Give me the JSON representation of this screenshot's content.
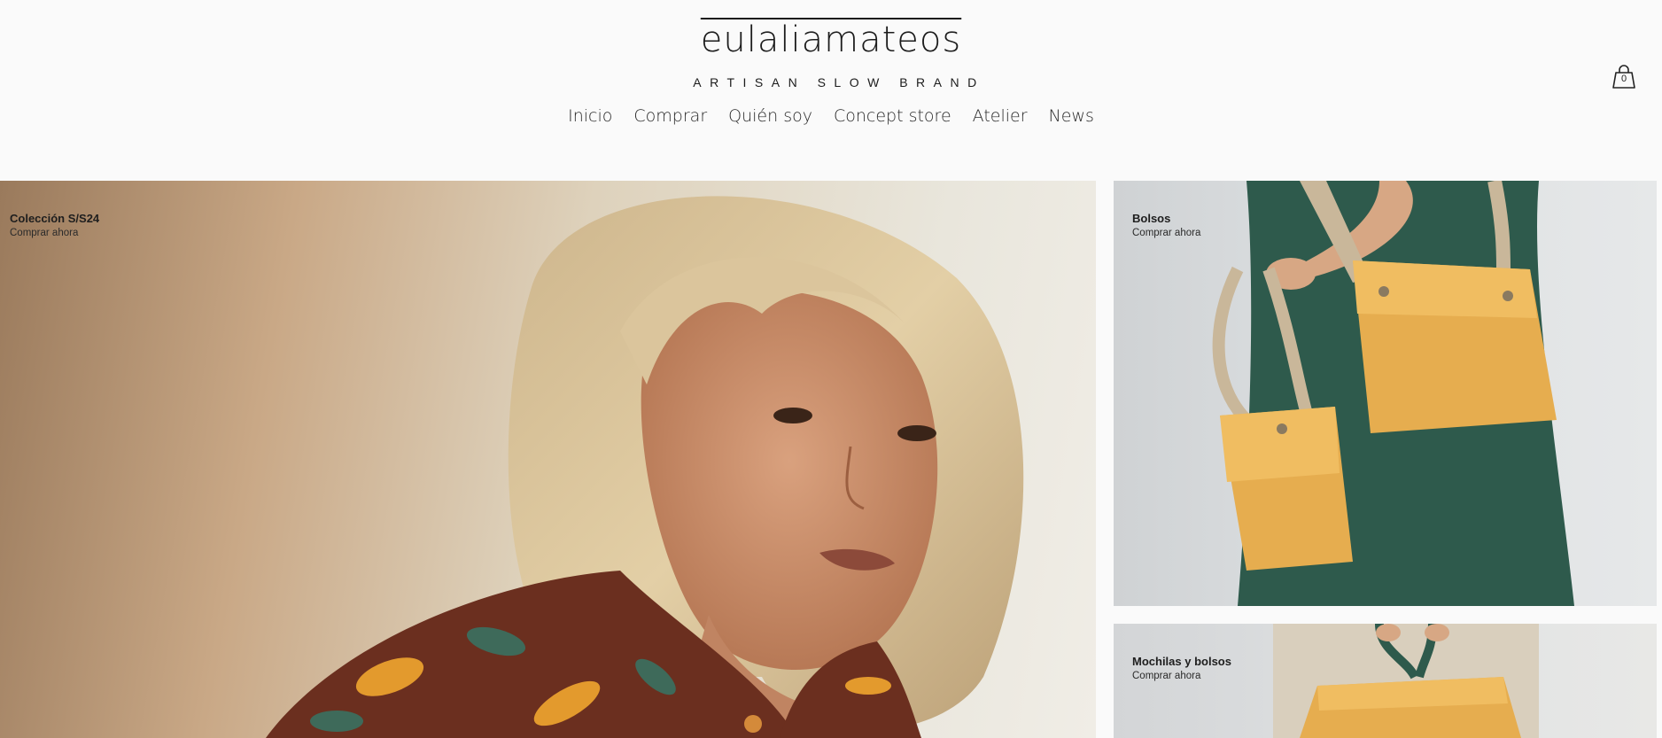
{
  "header": {
    "brand": "eulaliamateos",
    "tagline": "ARTISAN SLOW BRAND",
    "cart_count": "0"
  },
  "nav": {
    "items": [
      {
        "label": "Inicio"
      },
      {
        "label": "Comprar"
      },
      {
        "label": "Quién soy"
      },
      {
        "label": "Concept store"
      },
      {
        "label": "Atelier"
      },
      {
        "label": "News"
      }
    ]
  },
  "tiles": [
    {
      "title": "Colección S/S24",
      "cta": "Comprar ahora",
      "image": "woman-portrait-photo"
    },
    {
      "title": "Bolsos",
      "cta": "Comprar ahora",
      "image": "yellow-bags-photo"
    },
    {
      "title": "Mochilas y bolsos",
      "cta": "Comprar ahora",
      "image": "yellow-backpack-photo"
    }
  ],
  "colors": {
    "background": "#fafafa",
    "text": "#222222",
    "bag_yellow": "#e6ad4f",
    "dress_green": "#2e5a4c"
  }
}
